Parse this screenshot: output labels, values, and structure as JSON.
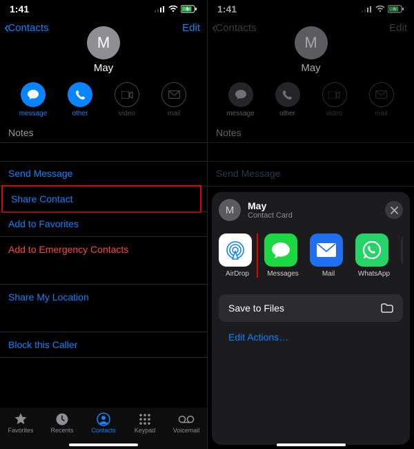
{
  "status": {
    "time": "1:41"
  },
  "nav": {
    "back": "Contacts",
    "edit": "Edit"
  },
  "contact": {
    "initial": "M",
    "name": "May"
  },
  "actions": {
    "message": "message",
    "other": "other",
    "video": "video",
    "mail": "mail"
  },
  "sections": {
    "notes": "Notes",
    "send_message": "Send Message",
    "share_contact": "Share Contact",
    "add_favorites": "Add to Favorites",
    "add_emergency": "Add to Emergency Contacts",
    "share_location": "Share My Location",
    "block": "Block this Caller"
  },
  "tabs": {
    "favorites": "Favorites",
    "recents": "Recents",
    "contacts": "Contacts",
    "keypad": "Keypad",
    "voicemail": "Voicemail"
  },
  "sheet": {
    "initial": "M",
    "title": "May",
    "subtitle": "Contact Card",
    "apps": {
      "airdrop": "AirDrop",
      "messages": "Messages",
      "mail": "Mail",
      "whatsapp": "WhatsApp"
    },
    "save_files": "Save to Files",
    "edit_actions": "Edit Actions…"
  }
}
